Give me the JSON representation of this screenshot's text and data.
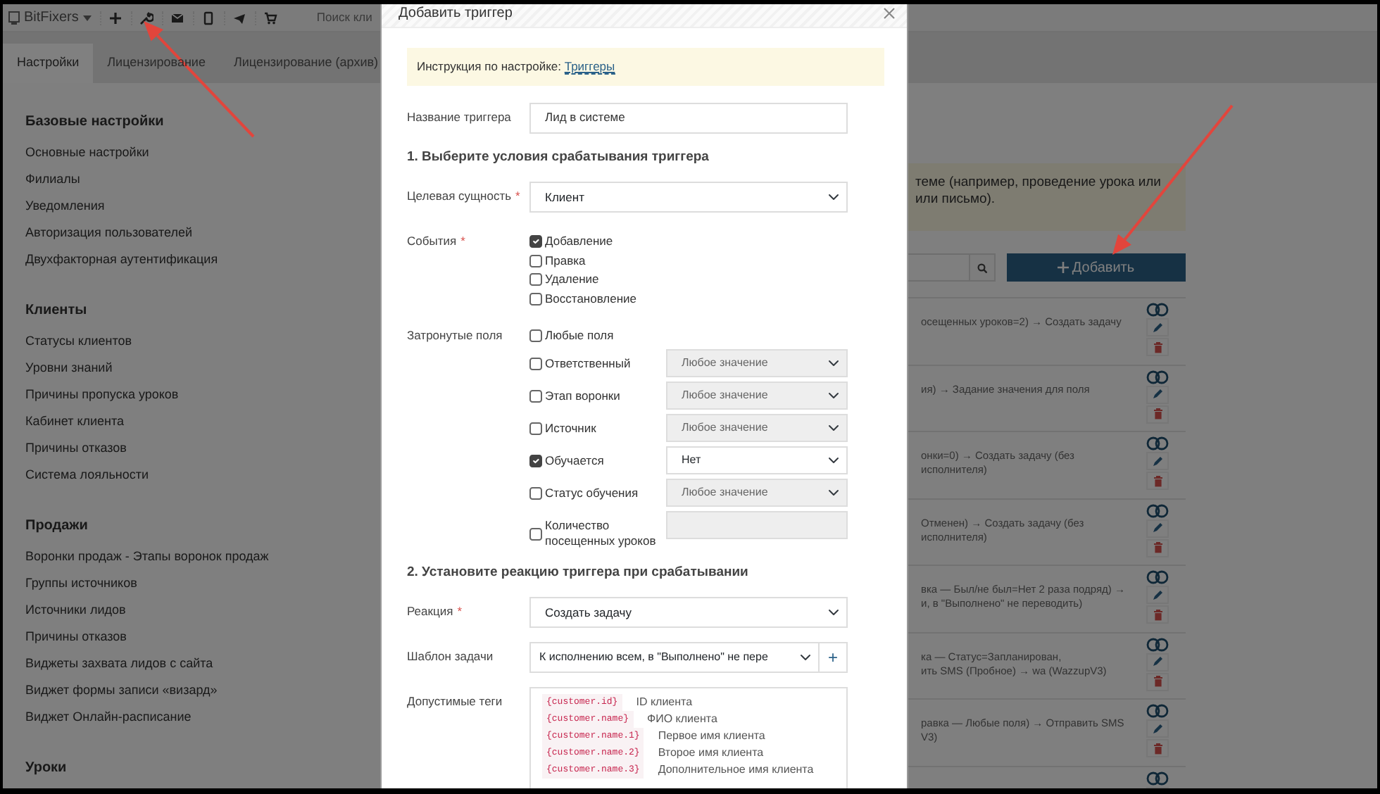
{
  "navbar": {
    "brand": "BitFixers",
    "search_placeholder": "Поиск кли"
  },
  "tabs": [
    {
      "label": "Настройки",
      "selected": true
    },
    {
      "label": "Лицензирование",
      "selected": false
    },
    {
      "label": "Лицензирование (архив)",
      "selected": false
    }
  ],
  "sidebar": {
    "sections": [
      {
        "title": "Базовые настройки",
        "items": [
          "Основные настройки",
          "Филиалы",
          "Уведомления",
          "Авторизация пользователей",
          "Двухфакторная аутентификация"
        ]
      },
      {
        "title": "Клиенты",
        "items": [
          "Статусы клиентов",
          "Уровни знаний",
          "Причины пропуска уроков",
          "Кабинет клиента",
          "Причины отказов",
          "Система лояльности"
        ]
      },
      {
        "title": "Продажи",
        "items": [
          "Воронки продаж - Этапы воронок продаж",
          "Группы источников",
          "Источники лидов",
          "Причины отказов",
          "Виджеты захвата лидов с сайта",
          "Виджет формы записи «визард»",
          "Виджет Онлайн-расписание"
        ]
      },
      {
        "title": "Уроки"
      }
    ]
  },
  "info_alert": {
    "lines": [
      "теме (например, проведение урока или",
      "или письмо)."
    ]
  },
  "add_button": {
    "label": "Добавить"
  },
  "triggers": [
    {
      "lines": [
        "осещенных уроков=2) → Создать задачу"
      ]
    },
    {
      "lines": [
        "ия) → Задание значения для поля"
      ]
    },
    {
      "lines": [
        "онки=0) → Создать задачу (без исполнителя)"
      ]
    },
    {
      "lines": [
        "Отменен) → Создать задачу (без исполнителя)"
      ]
    },
    {
      "lines": [
        "вка — Был/не был=Нет 2 раза подряд) →",
        "и, в \"Выполнено\" не переводить)"
      ]
    },
    {
      "lines": [
        "ка — Статус=Запланирован,",
        "ить SMS (Пробное) → wa (WazzupV3)"
      ]
    },
    {
      "lines": [
        "равка — Любые поля) → Отправить SMS",
        "V3)"
      ]
    }
  ],
  "trigger_list_cut_off": true,
  "modal": {
    "title": "Добавить триггер",
    "instruction": {
      "text": "Инструкция по настройке:",
      "link": "Триггеры"
    },
    "name_field": {
      "label": "Название триггера",
      "value": "Лид в системе"
    },
    "section_1": "1. Выберите условия срабатывания триггера",
    "target_entity": {
      "label": "Целевая сущность",
      "required_mark": "*",
      "value": "Клиент"
    },
    "events": {
      "label": "События",
      "required_mark": "*",
      "options": [
        {
          "label": "Добавление",
          "checked": true
        },
        {
          "label": "Правка",
          "checked": false
        },
        {
          "label": "Удаление",
          "checked": false
        },
        {
          "label": "Восстановление",
          "checked": false
        }
      ]
    },
    "affected_fields": {
      "label": "Затронутые поля",
      "items": [
        {
          "kind": "plain",
          "label": "Любые поля",
          "checked": false
        },
        {
          "kind": "select",
          "label": "Ответственный",
          "checked": false,
          "value": "Любое значение"
        },
        {
          "kind": "select",
          "label": "Этап воронки",
          "checked": false,
          "value": "Любое значение"
        },
        {
          "kind": "select",
          "label": "Источник",
          "checked": false,
          "value": "Любое значение"
        },
        {
          "kind": "select",
          "label": "Обучается",
          "checked": true,
          "value": "Нет"
        },
        {
          "kind": "select",
          "label": "Статус обучения",
          "checked": false,
          "value": "Любое значение"
        },
        {
          "kind": "input",
          "label": "Количество посещенных уроков",
          "checked": false
        }
      ]
    },
    "section_2": "2. Установите реакцию триггера при срабатывании",
    "reaction": {
      "label": "Реакция",
      "required_mark": "*",
      "value": "Создать задачу"
    },
    "task_template": {
      "label": "Шаблон задачи",
      "value": "К исполнению всем, в \"Выполнено\" не пере",
      "add_symbol": "+"
    },
    "tags": {
      "label": "Допустимые теги",
      "items": [
        {
          "code": "{customer.id}",
          "description": "ID клиента"
        },
        {
          "code": "{customer.name}",
          "description": "ФИО клиента"
        },
        {
          "code": "{customer.name.1}",
          "description": "Первое имя клиента"
        },
        {
          "code": "{customer.name.2}",
          "description": "Второе имя клиента"
        },
        {
          "code": "{customer.name.3}",
          "description": "Дополнительное имя клиента"
        }
      ]
    }
  }
}
